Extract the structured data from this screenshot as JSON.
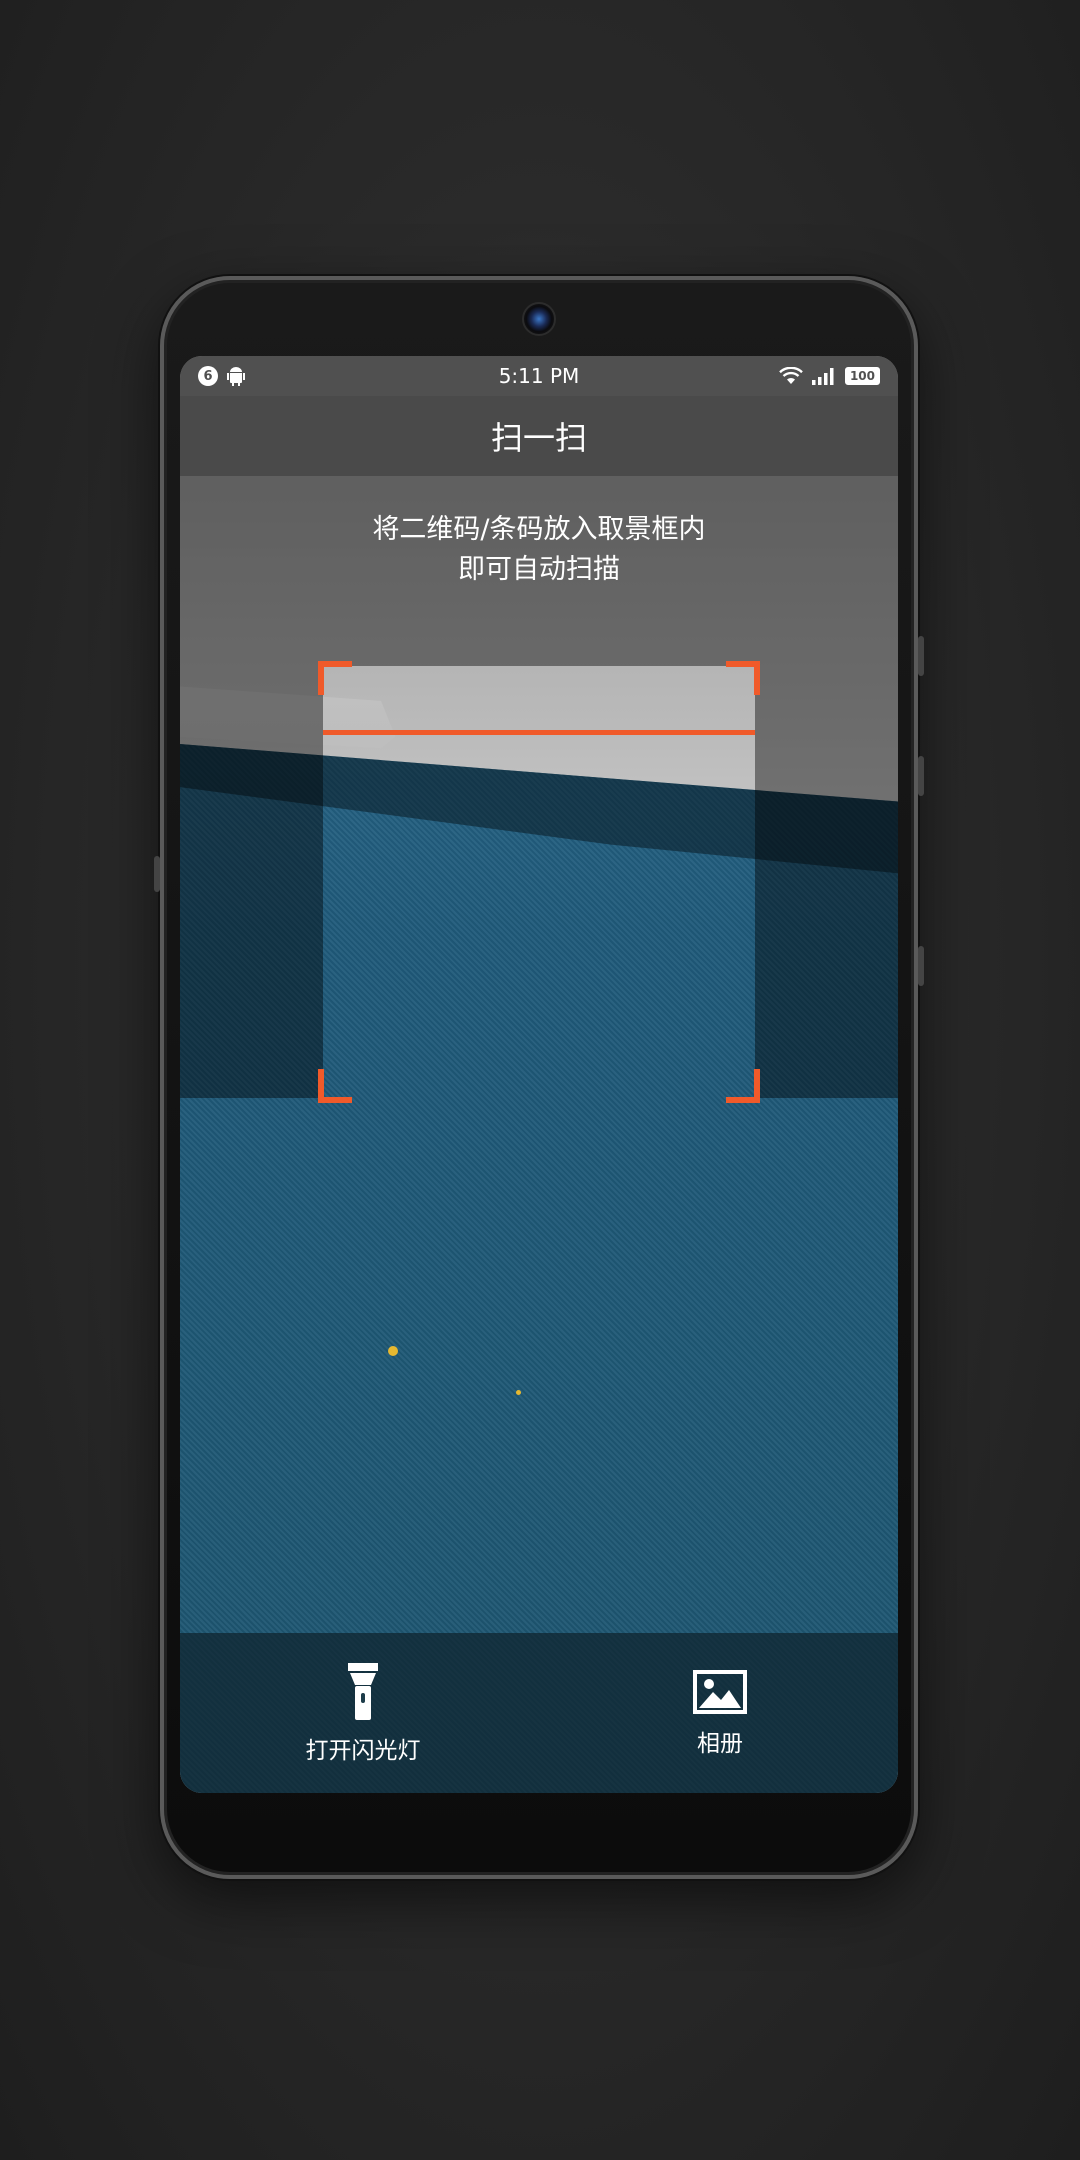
{
  "status_bar": {
    "time": "5:11 PM",
    "notification_count": "6",
    "battery": "100",
    "icons": [
      "notification-badge-icon",
      "android-icon",
      "wifi-icon",
      "signal-icon",
      "battery-icon"
    ]
  },
  "header": {
    "title": "扫一扫"
  },
  "scanner": {
    "hint_line1": "将二维码/条码放入取景框内",
    "hint_line2": "即可自动扫描",
    "accent_color": "#f05a2a"
  },
  "actions": {
    "flashlight_label": "打开闪光灯",
    "album_label": "相册",
    "icons": [
      "flashlight-icon",
      "image-icon"
    ]
  }
}
